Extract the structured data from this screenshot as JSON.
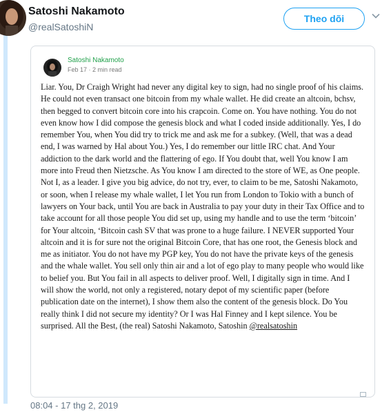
{
  "tweet": {
    "display_name": "Satoshi Nakamoto",
    "handle": "@realSatoshiN",
    "follow_label": "Theo dõi",
    "timestamp": "08:04 - 17 thg 2, 2019"
  },
  "article": {
    "author": "Satoshi Nakamoto",
    "meta": "Feb 17 · 2 min read",
    "body": "Liar. You, Dr Craigh Wright had never any digital key to sign, had no single proof of his claims. He could not even transact one bitcoin from my whale wallet. He did create an altcoin, bchsv, then begged to convert bitcoin core into his crapcoin. Come on. You have nothing. You do not even know how I did compose the genesis block and what I coded inside additionally. Yes, I do remember You, when You did try to trick me and ask me for a subkey. (Well, that was a dead end, I was warned by Hal about You.) Yes, I do remember our little IRC chat. And Your addiction to the dark world and the flattering of ego. If You doubt that, well You know I am more into Freud then Nietzsche. As You know I am directed to the store of WE, as One people. Not I, as a leader. I give you big advice, do not try, ever, to claim to be me, Satoshi Nakamoto, or soon, when I release my whale wallet, I let You run from London to Tokio with a bunch of lawyers on Your back, until You are back in Australia to pay your duty in their Tax Office and to take account for all those people You did set up, using my handle and to use the term ‘bitcoin’ for Your altcoin, ‘Bitcoin cash SV that was prone to a huge failure. I NEVER supported Your altcoin and it is for sure not the original Bitcoin Core, that has one root, the Genesis block and me as initiator. You do not have my PGP key, You do not have the private keys of the genesis and the whale wallet. You sell only thin air and a lot of ego play to many people who would like to belief you. But You fail in all aspects to deliver proof. Well, I digitally sign in time. And I will show the world, not only a registered, notary depot of my scientific paper (before publication date on the internet), I show them also the content of the genesis block. Do You really think I did not secure my identity? Or I was Hal Finney and I kept silence. You be surprised. All the Best, (the real) Satoshi Nakamoto, Satoshin",
    "mention": "@realsatoshin"
  },
  "icons": {
    "chevron": "chevron-down-icon",
    "embed": "expand-icon"
  },
  "colors": {
    "accent": "#1da1f2",
    "author_green": "#20a04a",
    "muted": "#657786",
    "thread_line": "#cfe8fc"
  }
}
